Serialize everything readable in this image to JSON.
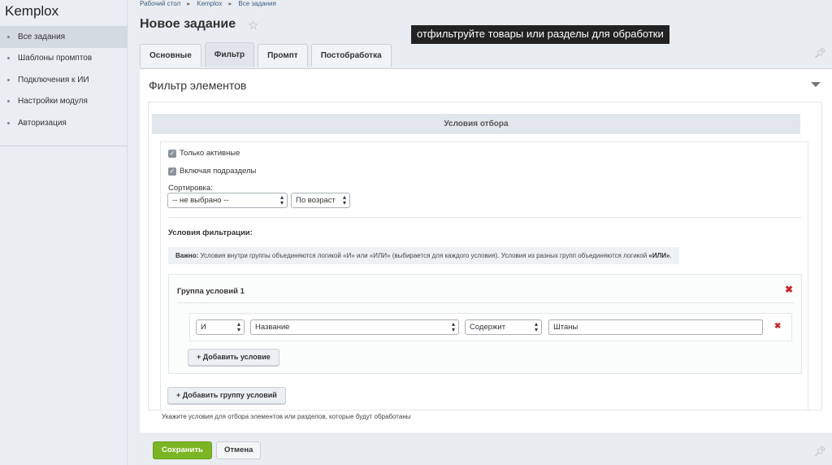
{
  "app": {
    "logo": "Kemplox"
  },
  "sidebar": {
    "items": [
      {
        "label": "Все задания",
        "active": true
      },
      {
        "label": "Шаблоны промптов"
      },
      {
        "label": "Подключения к ИИ"
      },
      {
        "label": "Настройки модуля"
      },
      {
        "label": "Авторизация"
      }
    ]
  },
  "breadcrumb": [
    "Рабочий стол",
    "Kemplox",
    "Все задания"
  ],
  "page": {
    "title": "Новое задание"
  },
  "tooltip": "отфильтруйте товары или разделы для обработки",
  "tabs": [
    "Основные",
    "Фильтр",
    "Промпт",
    "Постобработка"
  ],
  "panel": {
    "title": "Фильтр элементов",
    "section_title": "Условия отбора",
    "only_active": "Только активные",
    "include_subsections": "Включая подразделы",
    "sort_label": "Сортировка:",
    "sort_field": "-- не выбрано --",
    "sort_order": "По возраст",
    "filter_label": "Условия фильтрации:",
    "note_important": "Важно:",
    "note_text": " Условия внутри группы объединяются логикой «И» или «ИЛИ» (выбирается для каждого условия). Условия из разных групп объединяются логикой ",
    "note_or": "«ИЛИ»",
    "note_end": ".",
    "group_title": "Группа условий 1",
    "condition": {
      "logic": "И",
      "field": "Название",
      "operator": "Содержит",
      "value": "Штаны"
    },
    "add_condition": "+ Добавить условие",
    "add_group": "+ Добавить группу условий",
    "hint": "Укажите условия для отбора элементов или разделов, которые будут обработаны"
  },
  "footer": {
    "save": "Сохранить",
    "cancel": "Отмена"
  },
  "colors": {
    "accent_green": "#7cb524",
    "delete_red": "#c8262d"
  }
}
